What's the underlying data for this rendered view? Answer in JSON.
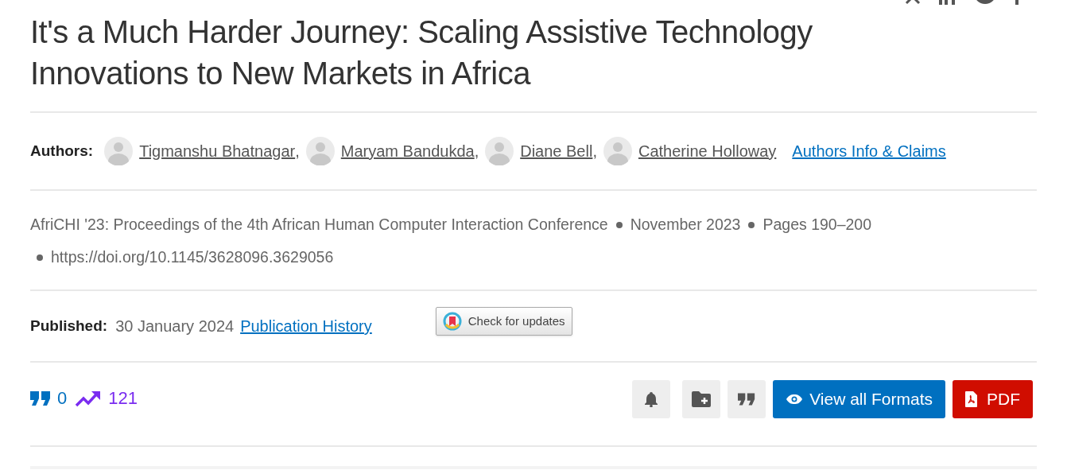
{
  "title": "It's a Much Harder Journey: Scaling Assistive Technology Innovations to New Markets in Africa",
  "authors_label": "Authors:",
  "authors": [
    {
      "name": "Tigmanshu Bhatnagar",
      "separator": ","
    },
    {
      "name": "Maryam Bandukda",
      "separator": ","
    },
    {
      "name": "Diane Bell",
      "separator": ","
    },
    {
      "name": "Catherine Holloway"
    }
  ],
  "authors_info_link": "Authors Info & Claims",
  "citation": {
    "venue": "AfriCHI '23: Proceedings of the 4th African Human Computer Interaction Conference",
    "date": "November 2023",
    "pages": "Pages 190–200",
    "doi": "https://doi.org/10.1145/3628096.3629056"
  },
  "published": {
    "label": "Published:",
    "date": "30 January 2024",
    "history_link": "Publication History"
  },
  "check_updates": "Check for updates",
  "metrics": {
    "citations": "0",
    "downloads": "121"
  },
  "actions": {
    "view_formats": "View all Formats",
    "pdf": "PDF"
  }
}
